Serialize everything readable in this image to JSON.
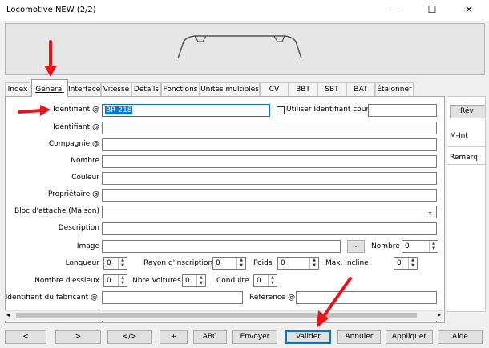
{
  "window": {
    "title": "Locomotive NEW (2/2)"
  },
  "tabs": [
    "Index",
    "Général",
    "Interface",
    "Vitesse",
    "Détails",
    "Fonctions",
    "Unités multiples",
    "CV",
    "BBT",
    "SBT",
    "BAT",
    "Étalonner"
  ],
  "form": {
    "identifiant_at_label": "Identifiant @",
    "identifiant_at_value": "BR 218",
    "use_short_id_label": "Utiliser Identifiant court",
    "identifiant2_label": "Identifiant @",
    "compagnie_label": "Compagnie @",
    "nombre_label": "Nombre",
    "couleur_label": "Couleur",
    "proprietaire_label": "Propriétaire @",
    "bloc_label": "Bloc d'attache (Maison)",
    "description_label": "Description",
    "image_label": "Image",
    "browse_label": "...",
    "image_nombre_label": "Nombre",
    "image_nombre_value": "0",
    "longueur_label": "Longueur",
    "longueur_value": "0",
    "rayon_label": "Rayon d'inscription",
    "rayon_value": "0",
    "poids_label": "Poids",
    "poids_value": "0",
    "max_incline_label": "Max. incline",
    "max_incline_value": "0",
    "essieux_label": "Nombre d'essieux",
    "essieux_value": "0",
    "voitures_label": "Nbre Voitures",
    "voitures_value": "0",
    "conduite_label": "Conduite",
    "conduite_value": "0",
    "fabricant_label": "Identifiant du fabricant @",
    "reference_label": "Référence @"
  },
  "side": {
    "button": "Rév",
    "mint": "M-Int",
    "remarks": "Remarq"
  },
  "bottom_buttons": [
    "<",
    ">",
    "</>",
    "+",
    "ABC",
    "Envoyer",
    "Valider",
    "Annuler",
    "Appliquer",
    "Aide"
  ],
  "colors": {
    "annotation_arrow": "#e8141b",
    "focus": "#0078d7"
  }
}
